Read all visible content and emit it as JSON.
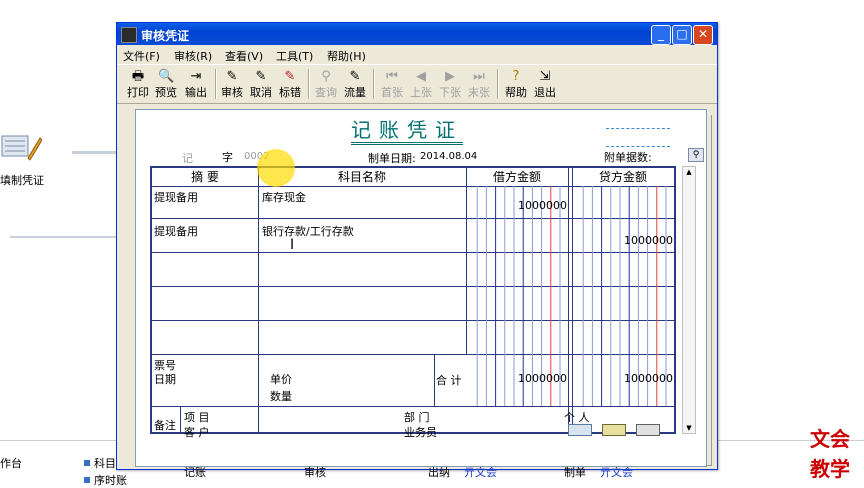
{
  "background": {
    "task_label": "填制凭证",
    "work_label": "作台",
    "list_items": [
      "科目",
      "序时账"
    ]
  },
  "brand": {
    "line1": "文会",
    "line2": "教学"
  },
  "window": {
    "title": "审核凭证",
    "menu": [
      "文件(F)",
      "审核(R)",
      "查看(V)",
      "工具(T)",
      "帮助(H)"
    ],
    "toolbar": [
      {
        "label": "打印",
        "icon": "printer-icon",
        "enabled": true
      },
      {
        "label": "预览",
        "icon": "preview-icon",
        "enabled": true
      },
      {
        "label": "输出",
        "icon": "export-icon",
        "enabled": true
      },
      {
        "label": "审核",
        "icon": "audit-icon",
        "enabled": true
      },
      {
        "label": "取消",
        "icon": "cancel-icon",
        "enabled": true
      },
      {
        "label": "标错",
        "icon": "mark-error-icon",
        "enabled": true
      },
      {
        "label": "查询",
        "icon": "query-icon",
        "enabled": false
      },
      {
        "label": "流量",
        "icon": "flow-icon",
        "enabled": true
      },
      {
        "label": "首张",
        "icon": "first-icon",
        "enabled": false
      },
      {
        "label": "上张",
        "icon": "prev-icon",
        "enabled": false
      },
      {
        "label": "下张",
        "icon": "next-icon",
        "enabled": false
      },
      {
        "label": "末张",
        "icon": "last-icon",
        "enabled": false
      },
      {
        "label": "帮助",
        "icon": "help-icon",
        "enabled": true
      },
      {
        "label": "退出",
        "icon": "exit-icon",
        "enabled": true
      }
    ]
  },
  "voucher": {
    "title": "记账凭证",
    "type_char": "记",
    "zi_label": "字",
    "number": "0002",
    "date_label": "制单日期:",
    "date": "2014.08.04",
    "attach_label": "附单据数:",
    "headers": {
      "summary": "摘 要",
      "account": "科目名称",
      "debit": "借方金额",
      "credit": "贷方金额"
    },
    "rows": [
      {
        "summary": "提现备用",
        "account": "库存现金",
        "debit": "1000000",
        "credit": ""
      },
      {
        "summary": "提现备用",
        "account": "银行存款/工行存款",
        "debit": "",
        "credit": "1000000"
      },
      {
        "summary": "",
        "account": "",
        "debit": "",
        "credit": ""
      },
      {
        "summary": "",
        "account": "",
        "debit": "",
        "credit": ""
      },
      {
        "summary": "",
        "account": "",
        "debit": "",
        "credit": ""
      }
    ],
    "footer": {
      "ticket_no": "票号",
      "date": "日期",
      "unit_price": "单价",
      "quantity": "数量",
      "total_label": "合 计",
      "total_debit": "1000000",
      "total_credit": "1000000"
    },
    "remark": {
      "label": "备注",
      "project": "项 目",
      "customer": "客 户",
      "department": "部 门",
      "salesman": "业务员",
      "person": "个 人"
    },
    "signatures": {
      "bookkeeper": "记账",
      "auditor": "审核",
      "cashier": "出纳",
      "cashier_name": "亓文会",
      "maker": "制单",
      "maker_name": "亓文会"
    }
  }
}
